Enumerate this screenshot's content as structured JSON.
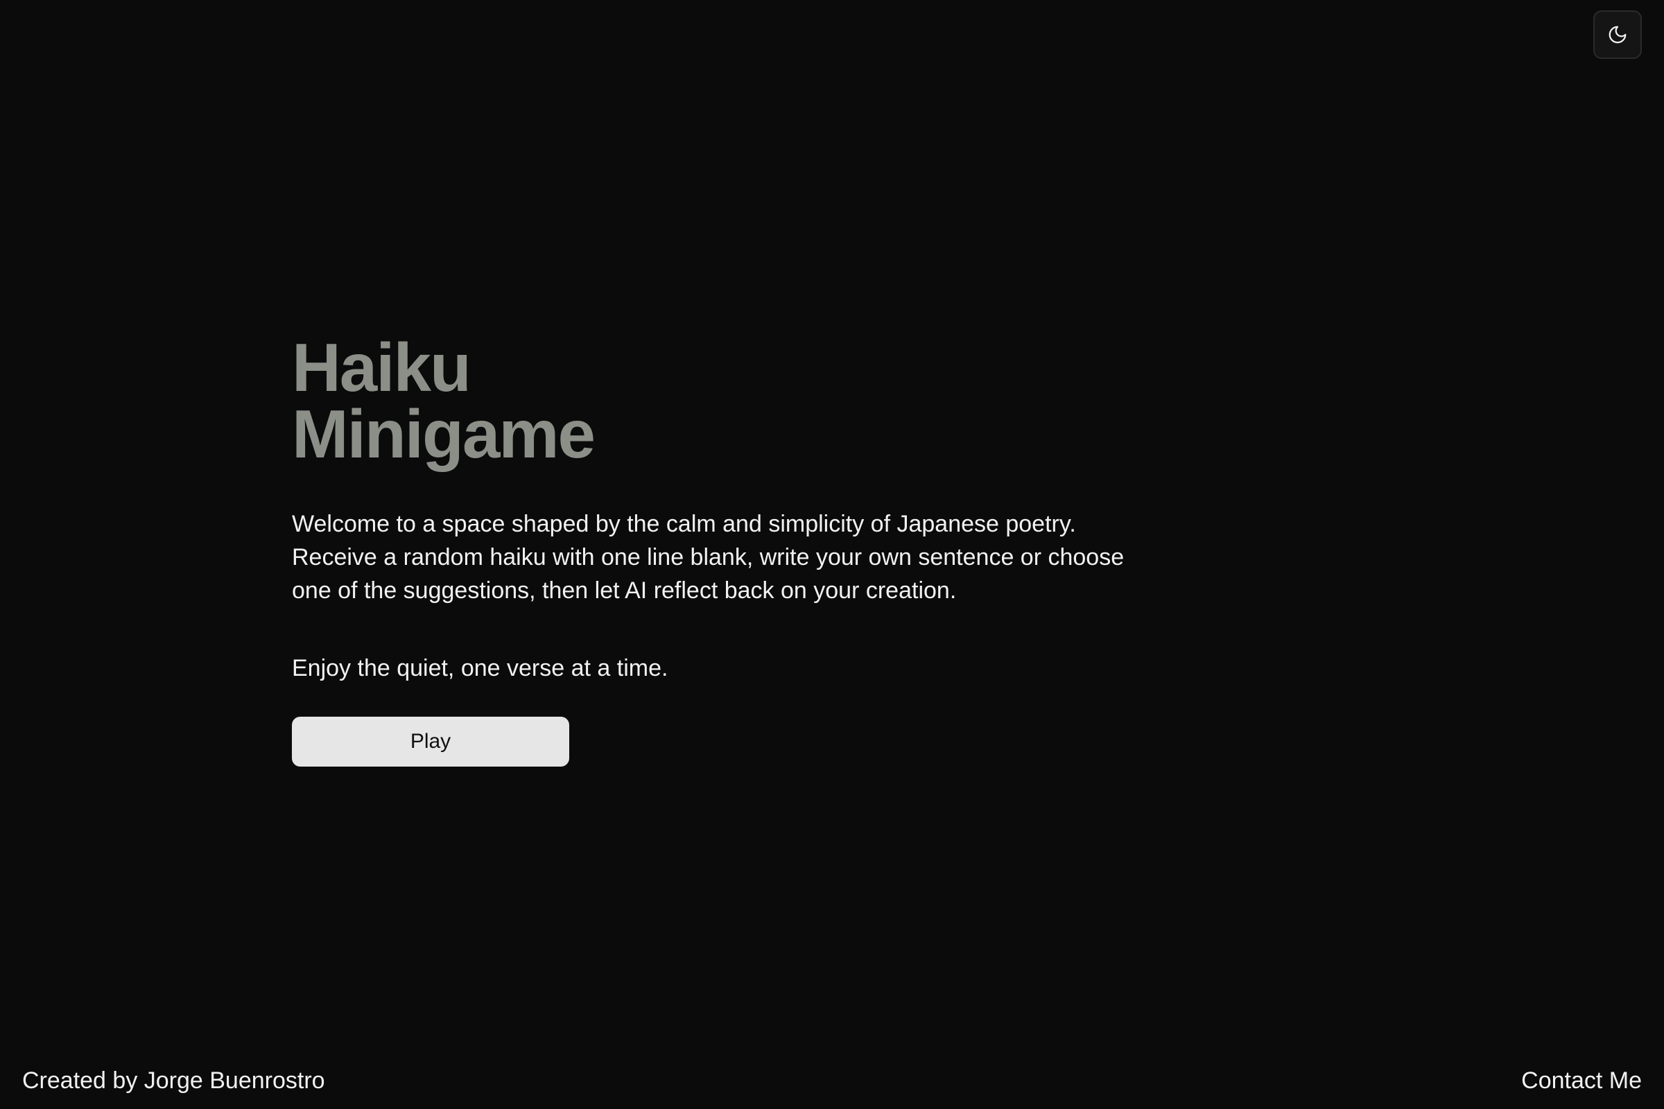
{
  "header": {
    "theme_toggle_icon": "moon-icon"
  },
  "hero": {
    "title_line1": "Haiku",
    "title_line2": "Minigame",
    "intro": "Welcome to a space shaped by the calm and simplicity of Japanese poetry. Receive a random haiku with one line blank, write your own sentence or choose one of the suggestions, then let AI reflect back on your creation.",
    "tagline": "Enjoy the quiet, one verse at a time.",
    "play_label": "Play"
  },
  "footer": {
    "credit": "Created by Jorge Buenrostro",
    "contact_label": "Contact Me"
  },
  "colors": {
    "background": "#0b0b0b",
    "title": "#8b8f88",
    "text": "#f2f2f2",
    "button_bg": "#e6e6e6",
    "button_text": "#111111"
  }
}
